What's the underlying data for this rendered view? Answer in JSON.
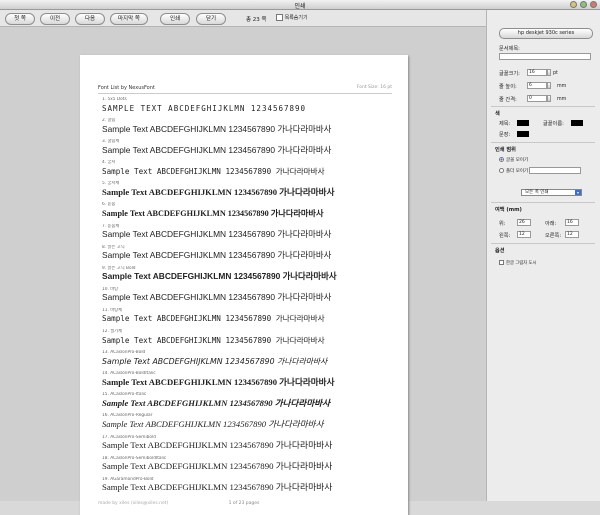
{
  "window": {
    "title": "인쇄"
  },
  "toolbar": {
    "first": "첫 쪽",
    "prev": "이전",
    "next": "다음",
    "last": "마지막 쪽",
    "print": "인쇄",
    "close": "닫기",
    "page_count": "총 23 쪽",
    "hide_label": "목록숨기기"
  },
  "page": {
    "header_title": "Font List by NexusFont",
    "header_size": "Font Size: 16 pt",
    "footer_left": "made by xiles (xiles@xiles.net)",
    "footer_center": "1 of 23 pages",
    "fonts": [
      {
        "name": "1. 5x5 Dots",
        "sample": "SAMPLE TEXT ABCDEFGHIJKLMN 1234567890"
      },
      {
        "name": "2. 굴림",
        "sample": "Sample Text ABCDEFGHIJKLMN 1234567890 가나다라마바사"
      },
      {
        "name": "3. 굴림체",
        "sample": "Sample Text ABCDEFGHIJKLMN 1234567890 가나다라마바사"
      },
      {
        "name": "4. 궁서",
        "sample": "Sample Text ABCDEFGHIJKLMN 1234567890 가나다라마바사"
      },
      {
        "name": "5. 궁서체",
        "sample": "Sample Text ABCDEFGHIJKLMN 1234567890 가나다라마바사"
      },
      {
        "name": "6. 돋움",
        "sample": "Sample Text ABCDEFGHIJKLMN 1234567890 가나다라마바사"
      },
      {
        "name": "7. 돋움체",
        "sample": "Sample Text ABCDEFGHIJKLMN 1234567890 가나다라마바사"
      },
      {
        "name": "8. 맑은 고딕",
        "sample": "Sample Text ABCDEFGHIJKLMN 1234567890 가나다라마바사"
      },
      {
        "name": "9. 맑은 고딕 Bold",
        "sample": "Sample Text ABCDEFGHIJKLMN 1234567890 가나다라마바사"
      },
      {
        "name": "10. 바탕",
        "sample": "Sample Text ABCDEFGHIJKLMN 1234567890 가나다라마바사"
      },
      {
        "name": "11. 바탕체",
        "sample": "Sample Text ABCDEFGHIJKLMN 1234567890 가나다라마바사"
      },
      {
        "name": "12. 필기체",
        "sample": "Sample Text ABCDEFGHIJKLMN 1234567890 가나다라마바사"
      },
      {
        "name": "13. ACaslonPro-Bold",
        "sample": "Sample Text ABCDEFGHIJKLMN 1234567890 가나다라마바사"
      },
      {
        "name": "14. ACaslonPro-BoldItalic",
        "sample": "Sample Text ABCDEFGHIJKLMN 1234567890 가나다라마바사"
      },
      {
        "name": "15. ACaslonPro-Italic",
        "sample": "Sample Text ABCDEFGHIJKLMN 1234567890 가나다라마바사"
      },
      {
        "name": "16. ACaslonPro-Regular",
        "sample": "Sample Text ABCDEFGHIJKLMN 1234567890 가나다라마바사"
      },
      {
        "name": "17. ACaslonPro-Semibold",
        "sample": "Sample Text ABCDEFGHIJKLMN 1234567890 가나다라마바사"
      },
      {
        "name": "18. ACaslonPro-SemiboldItalic",
        "sample": "Sample Text ABCDEFGHIJKLMN 1234567890 가나다라마바사"
      },
      {
        "name": "19. AGaramondPro-Bold",
        "sample": "Sample Text ABCDEFGHIJKLMN 1234567890 가나다라마바사"
      }
    ]
  },
  "sidebar": {
    "printer_button": "hp deskjet 930c series",
    "doc_title_label": "문서제목:",
    "font_size_label": "글꼴크기:",
    "font_size_value": "16",
    "font_size_unit": "pt",
    "row_height_label": "줄 높이:",
    "row_height_value": "6",
    "row_height_unit": "mm",
    "row_gap_label": "줄 간격:",
    "row_gap_value": "0",
    "row_gap_unit": "mm",
    "color_section": "색",
    "title_color_label": "제목:",
    "font_name_color_label": "글꼴이름:",
    "text_color_label": "문장:",
    "range_section": "인쇄 범위",
    "range_selected": "글꼴 모이기",
    "range_other": "폴더 모이기",
    "range_select_value": "모든 폭 인쇄",
    "margin_section": "여백 (mm)",
    "top_label": "위:",
    "top_value": "26",
    "bottom_label": "아래:",
    "bottom_value": "16",
    "left_label": "왼쪽:",
    "left_value": "12",
    "right_label": "오른쪽:",
    "right_value": "12",
    "options_section": "옵션",
    "option_label": "한글 그림자 도시"
  },
  "colors": {
    "accent": "#3a6fd8",
    "swatch": "#000000"
  }
}
